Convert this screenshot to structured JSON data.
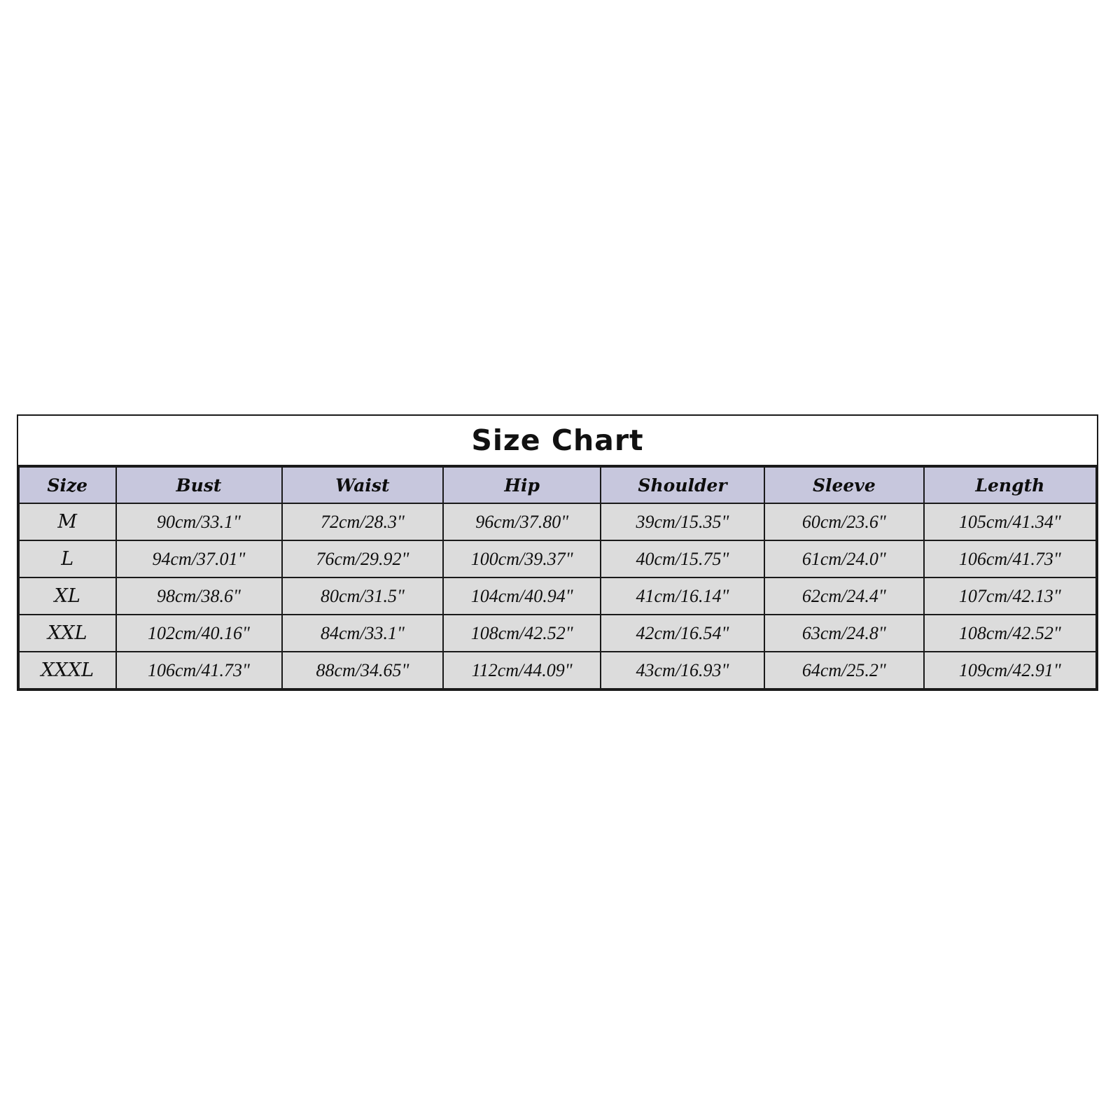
{
  "chart_data": {
    "type": "table",
    "title": "Size Chart",
    "columns": [
      "Size",
      "Bust",
      "Waist",
      "Hip",
      "Shoulder",
      "Sleeve",
      "Length"
    ],
    "rows": [
      {
        "size": "M",
        "bust": "90cm/33.1\"",
        "waist": "72cm/28.3\"",
        "hip": "96cm/37.80\"",
        "shoulder": "39cm/15.35\"",
        "sleeve": "60cm/23.6\"",
        "length": "105cm/41.34\""
      },
      {
        "size": "L",
        "bust": "94cm/37.01\"",
        "waist": "76cm/29.92\"",
        "hip": "100cm/39.37\"",
        "shoulder": "40cm/15.75\"",
        "sleeve": "61cm/24.0\"",
        "length": "106cm/41.73\""
      },
      {
        "size": "XL",
        "bust": "98cm/38.6\"",
        "waist": "80cm/31.5\"",
        "hip": "104cm/40.94\"",
        "shoulder": "41cm/16.14\"",
        "sleeve": "62cm/24.4\"",
        "length": "107cm/42.13\""
      },
      {
        "size": "XXL",
        "bust": "102cm/40.16\"",
        "waist": "84cm/33.1\"",
        "hip": "108cm/42.52\"",
        "shoulder": "42cm/16.54\"",
        "sleeve": "63cm/24.8\"",
        "length": "108cm/42.52\""
      },
      {
        "size": "XXXL",
        "bust": "106cm/41.73\"",
        "waist": "88cm/34.65\"",
        "hip": "112cm/44.09\"",
        "shoulder": "43cm/16.93\"",
        "sleeve": "64cm/25.2\"",
        "length": "109cm/42.91\""
      }
    ],
    "colors": {
      "page_background": "#ffffff",
      "header_row_background": "#c7c7dd",
      "body_row_background": "#dcdcdc",
      "border": "#1a1a1a",
      "text": "#0f0f0f"
    }
  }
}
